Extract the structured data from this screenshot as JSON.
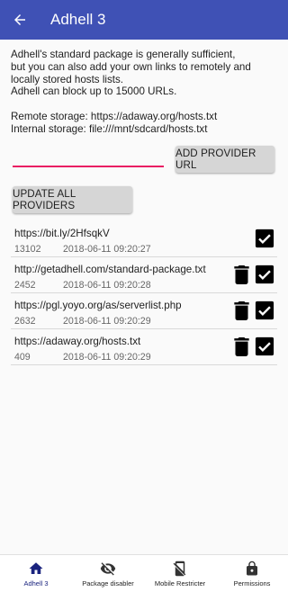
{
  "appbar": {
    "title": "Adhell 3",
    "back_icon": "arrow-back-icon"
  },
  "description": {
    "lines_a": [
      "Adhell's standard package is generally sufficient,",
      "but you can also add your own links to remotely and",
      "locally stored hosts lists.",
      "Adhell can block up to 15000 URLs."
    ],
    "lines_b": [
      "Remote storage: https://adaway.org/hosts.txt",
      "Internal storage: file:///mnt/sdcard/hosts.txt"
    ]
  },
  "url_input": {
    "value": "",
    "placeholder": ""
  },
  "buttons": {
    "add_provider": "ADD PROVIDER URL",
    "update_all": "UPDATE ALL PROVIDERS"
  },
  "providers": [
    {
      "url": "https://bit.ly/2HfsqkV",
      "count": "13102",
      "date": "2018-06-11 09:20:27",
      "deletable": false,
      "checked": true
    },
    {
      "url": "http://getadhell.com/standard-package.txt",
      "count": "2452",
      "date": "2018-06-11 09:20:28",
      "deletable": true,
      "checked": true
    },
    {
      "url": "https://pgl.yoyo.org/as/serverlist.php",
      "count": "2632",
      "date": "2018-06-11 09:20:29",
      "deletable": true,
      "checked": true
    },
    {
      "url": "https://adaway.org/hosts.txt",
      "count": "409",
      "date": "2018-06-11 09:20:29",
      "deletable": true,
      "checked": true
    }
  ],
  "bottom_nav": [
    {
      "label": "Adhell 3",
      "icon": "home-icon",
      "active": true
    },
    {
      "label": "Package disabler",
      "icon": "eye-off-icon",
      "active": false
    },
    {
      "label": "Mobile Restricter",
      "icon": "mobile-off-icon",
      "active": false
    },
    {
      "label": "Permissions",
      "icon": "lock-icon",
      "active": false
    }
  ],
  "colors": {
    "primary": "#3f51b5",
    "accent": "#e91e63",
    "nav_active": "#1a237e"
  }
}
